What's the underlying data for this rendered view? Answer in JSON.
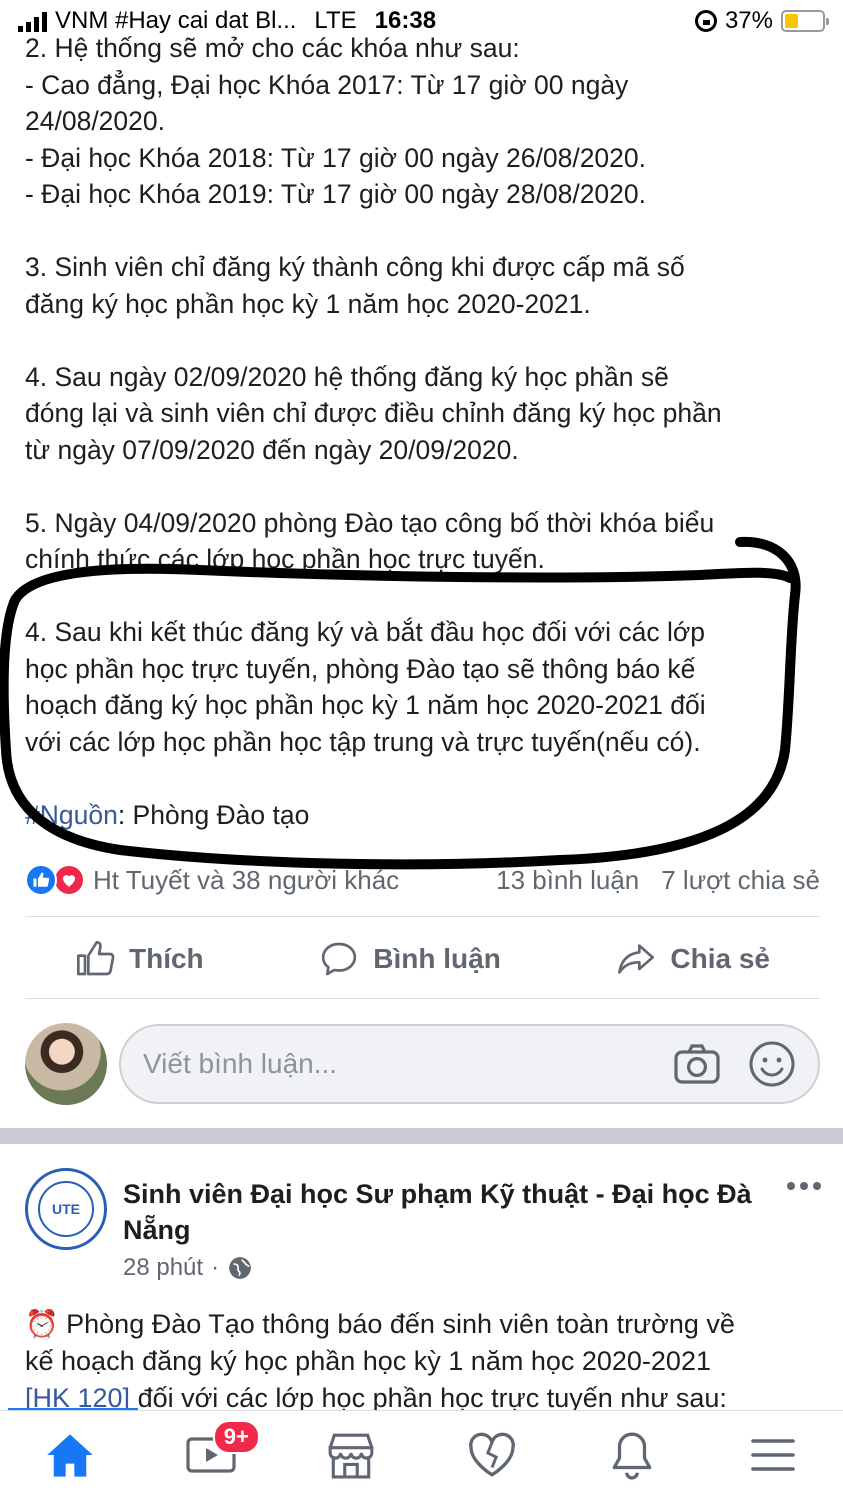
{
  "status_bar": {
    "carrier": "VNM #Hay cai dat Bl...",
    "network": "LTE",
    "time": "16:38",
    "battery_percent": "37%",
    "battery_level": 0.37
  },
  "post": {
    "lines": [
      "2. Hệ thống sẽ mở cho các khóa như sau:",
      "- Cao đẳng, Đại học Khóa 2017: Từ 17 giờ 00 ngày",
      "24/08/2020.",
      "- Đại học Khóa 2018: Từ 17 giờ 00 ngày 26/08/2020.",
      "- Đại học Khóa 2019: Từ 17 giờ 00 ngày 28/08/2020.",
      "",
      "3. Sinh viên chỉ đăng ký thành công khi được cấp mã số",
      "đăng ký học phần học kỳ 1 năm học 2020-2021.",
      "",
      "4. Sau ngày 02/09/2020 hệ thống đăng ký học phần sẽ",
      "đóng lại và sinh viên chỉ được điều chỉnh đăng ký học phần",
      "từ ngày 07/09/2020 đến ngày 20/09/2020.",
      "",
      "5. Ngày 04/09/2020 phòng Đào tạo công bố thời khóa biểu",
      "chính thức các lớp học phần học trực tuyến.",
      "",
      "4. Sau khi kết thúc đăng ký và bắt đầu học đối với các lớp",
      "học phần học trực tuyến, phòng Đào tạo sẽ thông báo kế",
      "hoạch đăng ký học phần học kỳ 1 năm học 2020-2021 đối",
      "với các lớp học phần học tập trung và trực tuyến(nếu có).",
      ""
    ],
    "source_hashtag": "#Nguồn",
    "source_text": ": Phòng Đào tạo"
  },
  "reactions": {
    "names": "Ht Tuyết và 38 người khác",
    "comments": "13 bình luận",
    "shares": "7 lượt chia sẻ"
  },
  "actions": {
    "like": "Thích",
    "comment": "Bình luận",
    "share": "Chia sẻ"
  },
  "comment_box": {
    "placeholder": "Viết bình luận..."
  },
  "next_post": {
    "page_name": "Sinh viên Đại học Sư phạm Kỹ thuật - Đại học Đà Nẵng",
    "logo_text": "UTE",
    "time": "28 phút",
    "separator": "·",
    "text_line1": "Phòng Đào Tạo thông báo đến sinh viên toàn trường về",
    "text_line2": "kế hoạch đăng ký học phần học kỳ 1 năm học 2020-2021",
    "text_link": "[HK 120]",
    "text_line3": " đối với các lớp học phần học trực tuyến như sau:"
  },
  "tab_bar": {
    "video_badge": "9+"
  },
  "colors": {
    "facebook_blue": "#1877f2",
    "link_blue": "#385898",
    "love_red": "#f0284a",
    "text_gray": "#606770"
  },
  "icons": [
    "home-icon",
    "watch-icon",
    "marketplace-icon",
    "dating-icon",
    "notifications-icon",
    "menu-icon",
    "camera-icon",
    "emoji-icon",
    "like-icon",
    "comment-icon",
    "share-icon",
    "globe-icon",
    "alarm-clock-icon"
  ]
}
